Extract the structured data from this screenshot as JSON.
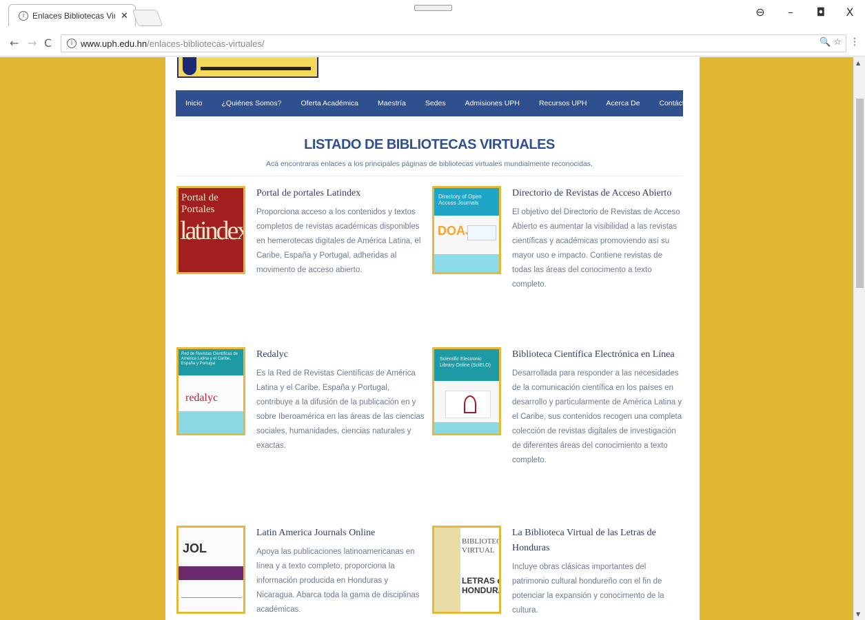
{
  "browser": {
    "tab_title": "Enlaces Bibliotecas Virtua",
    "tab_close": "✕",
    "url_host": "www.uph.edu.hn",
    "url_path": "/enlaces-bibliotecas-virtuales/",
    "window_controls": {
      "account": "⊖",
      "minimize": "–",
      "restore": "◘",
      "close": "X"
    },
    "nav": {
      "back": "←",
      "forward": "→",
      "reload": "C"
    },
    "omnibox_icons": "🔍 ☆",
    "menu": "⋮"
  },
  "nav_menu": [
    "Inicio",
    "¿Quiénes Somos?",
    "Oferta Académica",
    "Maestría",
    "Sedes",
    "Admisiones UPH",
    "Recursos UPH",
    "Acerca De",
    "Contáctenos"
  ],
  "heading": "LISTADO DE BIBLIOTECAS VIRTUALES",
  "subheading": "Acá encontraras enlaces a los principales páginas de bibliotecas virtuales mundialmente reconocidas.",
  "cards": [
    {
      "title": "Portal de portales Latindex",
      "description": "Proporciona acceso a los contenidos y textos completos de revistas académicas disponibles en hemerotecas digitales de América Latina, el Caribe, España y Portugal, adheridas al movimento de acceso abierto.",
      "thumb_text_a": "Portal de Portales",
      "thumb_text_b": "latindex"
    },
    {
      "title": "Directorio de Revistas de Acceso Abierto",
      "description": "El objetivo del Directorio de Revistas de Acceso Abierto es aumentar la visibilidad a las revistas científicas y académicas promoviendo así su mayor uso e impacto. Contiene revistas de todas las áreas del conocimento a texto completo.",
      "thumb_text_a": "Directory of Open Access Journals",
      "thumb_text_b": "DOAJ"
    },
    {
      "title": "Redalyc",
      "description": "Es la Red de Revistas Científicas de América Latina y el Caribe, España y Portugal, contribuye a la difusión de la publicación en y sobre Iberoamérica en las áreas de las ciencias sociales, humanidades, ciencias naturales y exactas.",
      "thumb_text_a": "Red de Revistas Científicas de América Latina y el Caribe, España y Portugal",
      "thumb_text_b": "redalyc"
    },
    {
      "title": "Biblioteca Científica Electrónica en Línea",
      "description": "Desarrollada para responder a las necesidades de la comunicación científica en los países en desarrollo y particularmente de América Latina y el Caribe, sus contenidos recogen una completa colección de revistas digitales de investigación de diferentes áreas del conocimiento a texto completo.",
      "thumb_text_a": "Scientific Electronic Library Online (SciELO)"
    },
    {
      "title": "Latin America Journals Online",
      "description": "Apoya las publicaciones latinoamericanas en línea y a texto completo, proporciona la información producida en Honduras y Nicaragua. Abarca toda la gama de disciplinas académicas.",
      "thumb_text_a": "JOL"
    },
    {
      "title": "La Biblioteca Virtual de las Letras de Honduras",
      "description": "Incluye obras clásicas importantes del patrimonio cultural hondureño con el fin de potenciar la expansión y conocimento de la cultura.",
      "thumb_text_a": "BIBLIOTECA VIRTUAL",
      "thumb_text_b": "LETRAS de HONDURAS"
    }
  ],
  "colors": {
    "page_bg": "#e0b731",
    "nav_bg": "#2f4f8f",
    "heading": "#2f4f8f",
    "accent_border": "#e7b837"
  }
}
